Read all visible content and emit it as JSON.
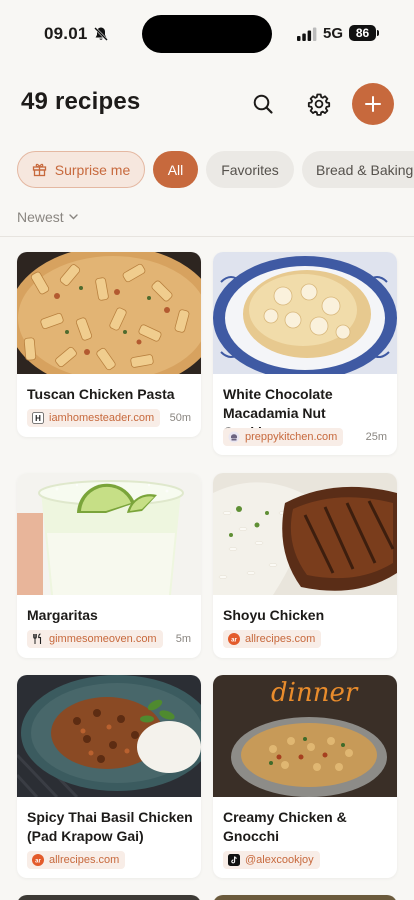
{
  "status": {
    "time": "09.01",
    "network": "5G",
    "battery": "86"
  },
  "header": {
    "title": "49 recipes"
  },
  "filters": {
    "surprise": "Surprise me",
    "all": "All",
    "favorites": "Favorites",
    "bread": "Bread & Baking"
  },
  "sort": {
    "label": "Newest"
  },
  "colors": {
    "accent": "#c7693d",
    "background": "#f8f7f4"
  },
  "recipes": [
    {
      "title": "Tuscan Chicken Pasta",
      "source": "iamhomesteader.com",
      "time": "50m",
      "source_icon": "h-logo-icon"
    },
    {
      "title": "White Chocolate Macadamia Nut Cookie…",
      "source": "preppykitchen.com",
      "time": "25m",
      "source_icon": "chef-logo-icon"
    },
    {
      "title": "Margaritas",
      "source": "gimmesomeoven.com",
      "time": "5m",
      "source_icon": "utensils-icon"
    },
    {
      "title": "Shoyu Chicken",
      "source": "allrecipes.com",
      "time": "",
      "source_icon": "allrecipes-logo-icon"
    },
    {
      "title": "Spicy Thai Basil Chicken (Pad Krapow Gai)",
      "source": "allrecipes.com",
      "time": "",
      "source_icon": "allrecipes-logo-icon"
    },
    {
      "title": "Creamy Chicken & Gnocchi",
      "source": "@alexcookjoy",
      "time": "",
      "source_icon": "tiktok-icon",
      "image_overlay": "dinner"
    }
  ]
}
